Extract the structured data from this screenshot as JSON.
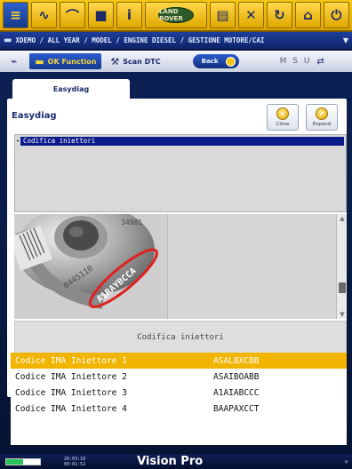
{
  "toolbar": {
    "logo_text": "LAND ROVER"
  },
  "breadcrumb": {
    "path": "XDEMO / ALL YEAR / MODEL / ENGINE DIESEL / GESTIONE MOTORE/CAI"
  },
  "funcbar": {
    "ok_function": "OK Function",
    "scan_dtc": "Scan DTC",
    "back": "Back",
    "msu": "M S U"
  },
  "tab": {
    "label": "Easydiag"
  },
  "panel": {
    "title": "Easydiag",
    "close_label": "Close",
    "expand_label": "Expand",
    "selected_item": "Codifica iniettori",
    "photo_code": "A1RAYBCCA",
    "caption": "Codifica iniettori"
  },
  "table": {
    "rows": [
      {
        "label": "Codice IMA Iniettore 1",
        "value": "ASALBXCBB"
      },
      {
        "label": "Codice IMA Iniettore 2",
        "value": "ASAIBOABB"
      },
      {
        "label": "Codice IMA Iniettore 3",
        "value": "A1AIABCCC"
      },
      {
        "label": "Codice IMA Iniettore 4",
        "value": "BAAPAXCCT"
      }
    ]
  },
  "status": {
    "time1": "26:03:18",
    "time2": "09:01:52",
    "brand": "Vision Pro",
    "battery_level": 0.5
  },
  "colors": {
    "accent_yellow": "#f1b500",
    "navy": "#0b1b8a"
  }
}
